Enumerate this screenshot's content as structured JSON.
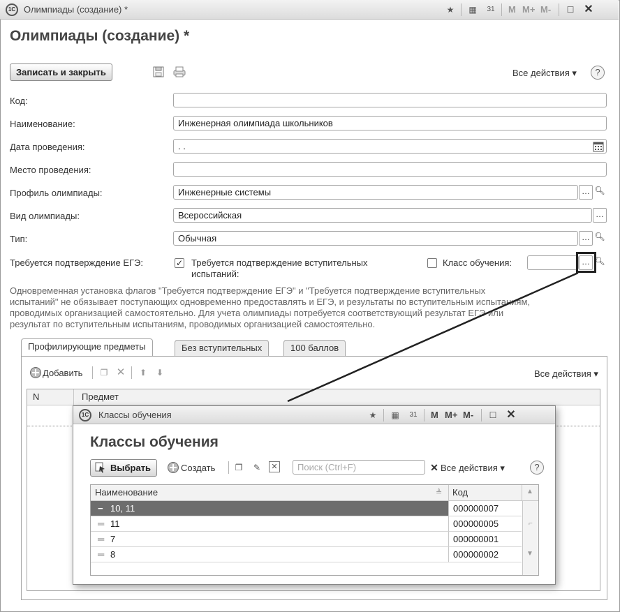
{
  "window": {
    "title": "Олимпиады (создание) *",
    "heading": "Олимпиады (создание) *",
    "toolbar": {
      "m": "M",
      "mplus": "M+",
      "mminus": "M-"
    }
  },
  "commandbar": {
    "save_close": "Записать и закрыть",
    "all_actions": "Все действия ▾",
    "help": "?"
  },
  "form": {
    "code_label": "Код:",
    "code_value": "",
    "name_label": "Наименование:",
    "name_value": "Инженерная олимпиада школьников",
    "date_label": "Дата проведения:",
    "date_value": ". .",
    "place_label": "Место проведения:",
    "place_value": "",
    "profile_label": "Профиль олимпиады:",
    "profile_value": "Инженерные системы",
    "kind_label": "Вид олимпиады:",
    "kind_value": "Всероссийская",
    "type_label": "Тип:",
    "type_value": "Обычная",
    "ege_label": "Требуется подтверждение ЕГЭ:",
    "entrance_label_1": "Требуется подтверждение вступительных",
    "entrance_label_2": "испытаний:",
    "class_label": "Класс обучения:",
    "class_value": ""
  },
  "hint": {
    "line1": "Одновременная установка флагов \"Требуется подтверждение ЕГЭ\" и \"Требуется подтверждение вступительных",
    "line2": "испытаний\" не обязывает поступающих одновременно предоставлять и ЕГЭ, и результаты по вступительным испытаниям,",
    "line3": "проводимых организацией самостоятельно. Для учета олимпиады потребуется соответствующий результат ЕГЭ или",
    "line4": "результат по вступительным испытаниям, проводимых организацией самостоятельно."
  },
  "tabs": [
    {
      "label": "Профилирующие предметы"
    },
    {
      "label": "Без вступительных"
    },
    {
      "label": "100 баллов"
    }
  ],
  "subtable": {
    "add": "Добавить",
    "all_actions": "Все действия ▾",
    "col_n": "N",
    "col_subject": "Предмет"
  },
  "popup": {
    "title": "Классы обучения",
    "heading": "Классы обучения",
    "select": "Выбрать",
    "create": "Создать",
    "search_placeholder": "Поиск (Ctrl+F)",
    "all_actions": "Все действия ▾",
    "help": "?",
    "col_name": "Наименование",
    "col_code": "Код",
    "rows": [
      {
        "name": "10, 11",
        "code": "000000007"
      },
      {
        "name": "11",
        "code": "000000005"
      },
      {
        "name": "7",
        "code": "000000001"
      },
      {
        "name": "8",
        "code": "000000002"
      }
    ]
  }
}
